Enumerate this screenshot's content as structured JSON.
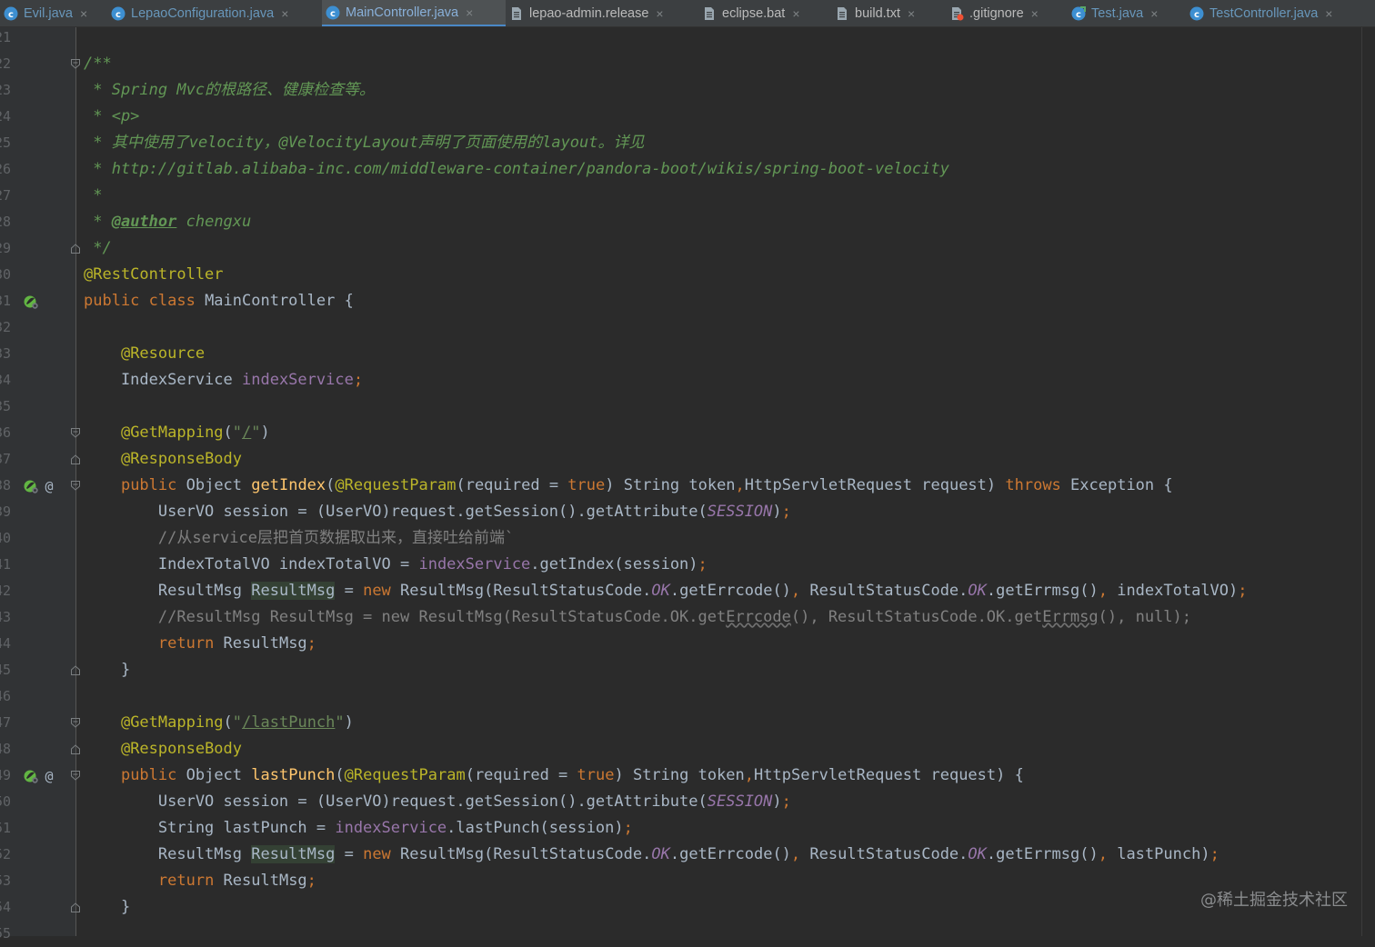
{
  "tabs": [
    {
      "label": "Evil.java",
      "kind": "java",
      "active": false
    },
    {
      "label": "LepaoConfiguration.java",
      "kind": "java",
      "active": false
    },
    {
      "label": "MainController.java",
      "kind": "java",
      "active": true
    },
    {
      "label": "lepao-admin.release",
      "kind": "file",
      "active": false
    },
    {
      "label": "eclipse.bat",
      "kind": "file",
      "active": false
    },
    {
      "label": "build.txt",
      "kind": "file",
      "active": false
    },
    {
      "label": ".gitignore",
      "kind": "git",
      "active": false
    },
    {
      "label": "Test.java",
      "kind": "java-test",
      "active": false
    },
    {
      "label": "TestController.java",
      "kind": "java",
      "active": false
    }
  ],
  "close_glyph": "×",
  "lines": [
    {
      "n": "21",
      "tokens": []
    },
    {
      "n": "22",
      "fold": "open",
      "tokens": [
        {
          "t": "/**",
          "c": "doc"
        }
      ]
    },
    {
      "n": "23",
      "tokens": [
        {
          "t": " * Spring Mvc的根路径、健康检查等。",
          "c": "doc"
        }
      ]
    },
    {
      "n": "24",
      "tokens": [
        {
          "t": " * <p>",
          "c": "doc"
        }
      ]
    },
    {
      "n": "25",
      "tokens": [
        {
          "t": " * 其中使用了velocity，@VelocityLayout声明了页面使用的layout。详见",
          "c": "doc"
        }
      ]
    },
    {
      "n": "26",
      "tokens": [
        {
          "t": " * http://gitlab.alibaba-inc.com/middleware-container/pandora-boot/wikis/spring-boot-velocity",
          "c": "doc"
        }
      ]
    },
    {
      "n": "27",
      "tokens": [
        {
          "t": " *",
          "c": "doc"
        }
      ]
    },
    {
      "n": "28",
      "tokens": [
        {
          "t": " * ",
          "c": "doc"
        },
        {
          "t": "@author",
          "c": "doctag"
        },
        {
          "t": " chengxu",
          "c": "doc"
        }
      ]
    },
    {
      "n": "29",
      "fold": "close",
      "tokens": [
        {
          "t": " */",
          "c": "doc"
        }
      ]
    },
    {
      "n": "30",
      "tokens": [
        {
          "t": "@RestController",
          "c": "ann"
        }
      ]
    },
    {
      "n": "31",
      "icon": "bean",
      "tokens": [
        {
          "t": "public class ",
          "c": "kw"
        },
        {
          "t": "MainController {"
        }
      ]
    },
    {
      "n": "32",
      "tokens": []
    },
    {
      "n": "33",
      "tokens": [
        {
          "t": "    "
        },
        {
          "t": "@Resource",
          "c": "ann"
        }
      ]
    },
    {
      "n": "34",
      "tokens": [
        {
          "t": "    IndexService "
        },
        {
          "t": "indexService",
          "c": "field"
        },
        {
          "t": ";",
          "c": "kw"
        }
      ]
    },
    {
      "n": "35",
      "tokens": []
    },
    {
      "n": "36",
      "fold": "open",
      "tokens": [
        {
          "t": "    "
        },
        {
          "t": "@GetMapping",
          "c": "ann"
        },
        {
          "t": "("
        },
        {
          "t": "\"",
          "c": "str"
        },
        {
          "t": "/",
          "c": "str ul"
        },
        {
          "t": "\"",
          "c": "str"
        },
        {
          "t": ")"
        }
      ]
    },
    {
      "n": "37",
      "fold": "close",
      "tokens": [
        {
          "t": "    "
        },
        {
          "t": "@ResponseBody",
          "c": "ann"
        }
      ]
    },
    {
      "n": "38",
      "icon": "bean",
      "at": "@",
      "fold": "open",
      "tokens": [
        {
          "t": "    "
        },
        {
          "t": "public ",
          "c": "kw"
        },
        {
          "t": "Object "
        },
        {
          "t": "getIndex",
          "c": "fn"
        },
        {
          "t": "("
        },
        {
          "t": "@RequestParam",
          "c": "ann"
        },
        {
          "t": "(required = "
        },
        {
          "t": "true",
          "c": "kw"
        },
        {
          "t": ") String token"
        },
        {
          "t": ",",
          "c": "kw"
        },
        {
          "t": "HttpServletRequest request) "
        },
        {
          "t": "throws ",
          "c": "kw"
        },
        {
          "t": "Exception {"
        }
      ]
    },
    {
      "n": "39",
      "tokens": [
        {
          "t": "        UserVO session = (UserVO)request.getSession().getAttribute("
        },
        {
          "t": "SESSION",
          "c": "cst"
        },
        {
          "t": ")"
        },
        {
          "t": ";",
          "c": "kw"
        }
      ]
    },
    {
      "n": "40",
      "tokens": [
        {
          "t": "        //从service层把首页数据取出来，直接吐给前端`",
          "c": "cmt"
        }
      ]
    },
    {
      "n": "41",
      "tokens": [
        {
          "t": "        IndexTotalVO indexTotalVO = "
        },
        {
          "t": "indexService",
          "c": "field"
        },
        {
          "t": ".getIndex(session)"
        },
        {
          "t": ";",
          "c": "kw"
        }
      ]
    },
    {
      "n": "42",
      "tokens": [
        {
          "t": "        ResultMsg "
        },
        {
          "t": "ResultMsg",
          "c": "hl"
        },
        {
          "t": " = "
        },
        {
          "t": "new ",
          "c": "kw"
        },
        {
          "t": "ResultMsg(ResultStatusCode."
        },
        {
          "t": "OK",
          "c": "cst"
        },
        {
          "t": ".getErrcode()"
        },
        {
          "t": ", ",
          "c": "kw"
        },
        {
          "t": "ResultStatusCode."
        },
        {
          "t": "OK",
          "c": "cst"
        },
        {
          "t": ".getErrmsg()"
        },
        {
          "t": ", ",
          "c": "kw"
        },
        {
          "t": "indexTotalVO)"
        },
        {
          "t": ";",
          "c": "kw"
        }
      ]
    },
    {
      "n": "43",
      "tokens": [
        {
          "t": "        //ResultMsg ResultMsg = new ResultMsg(ResultStatusCode.OK.get",
          "c": "cmt"
        },
        {
          "t": "Errcode",
          "c": "cmt wavy"
        },
        {
          "t": "(), ResultStatusCode.OK.get",
          "c": "cmt"
        },
        {
          "t": "Errmsg",
          "c": "cmt wavy"
        },
        {
          "t": "(), null);",
          "c": "cmt"
        }
      ]
    },
    {
      "n": "44",
      "tokens": [
        {
          "t": "        "
        },
        {
          "t": "return ",
          "c": "kw"
        },
        {
          "t": "ResultMsg"
        },
        {
          "t": ";",
          "c": "kw"
        }
      ]
    },
    {
      "n": "45",
      "fold": "close",
      "tokens": [
        {
          "t": "    }"
        }
      ]
    },
    {
      "n": "46",
      "tokens": []
    },
    {
      "n": "47",
      "fold": "open",
      "tokens": [
        {
          "t": "    "
        },
        {
          "t": "@GetMapping",
          "c": "ann"
        },
        {
          "t": "("
        },
        {
          "t": "\"",
          "c": "str"
        },
        {
          "t": "/lastPunch",
          "c": "str ul"
        },
        {
          "t": "\"",
          "c": "str"
        },
        {
          "t": ")"
        }
      ]
    },
    {
      "n": "48",
      "fold": "close",
      "tokens": [
        {
          "t": "    "
        },
        {
          "t": "@ResponseBody",
          "c": "ann"
        }
      ]
    },
    {
      "n": "49",
      "icon": "bean",
      "at": "@",
      "fold": "open",
      "tokens": [
        {
          "t": "    "
        },
        {
          "t": "public ",
          "c": "kw"
        },
        {
          "t": "Object "
        },
        {
          "t": "lastPunch",
          "c": "fn"
        },
        {
          "t": "("
        },
        {
          "t": "@RequestParam",
          "c": "ann"
        },
        {
          "t": "(required = "
        },
        {
          "t": "true",
          "c": "kw"
        },
        {
          "t": ") String token"
        },
        {
          "t": ",",
          "c": "kw"
        },
        {
          "t": "HttpServletRequest request) {"
        }
      ]
    },
    {
      "n": "50",
      "tokens": [
        {
          "t": "        UserVO session = (UserVO)request.getSession().getAttribute("
        },
        {
          "t": "SESSION",
          "c": "cst"
        },
        {
          "t": ")"
        },
        {
          "t": ";",
          "c": "kw"
        }
      ]
    },
    {
      "n": "51",
      "tokens": [
        {
          "t": "        String lastPunch = "
        },
        {
          "t": "indexService",
          "c": "field"
        },
        {
          "t": ".lastPunch(session)"
        },
        {
          "t": ";",
          "c": "kw"
        }
      ]
    },
    {
      "n": "52",
      "tokens": [
        {
          "t": "        ResultMsg "
        },
        {
          "t": "ResultMsg",
          "c": "hl"
        },
        {
          "t": " = "
        },
        {
          "t": "new ",
          "c": "kw"
        },
        {
          "t": "ResultMsg(ResultStatusCode."
        },
        {
          "t": "OK",
          "c": "cst"
        },
        {
          "t": ".getErrcode()"
        },
        {
          "t": ", ",
          "c": "kw"
        },
        {
          "t": "ResultStatusCode."
        },
        {
          "t": "OK",
          "c": "cst"
        },
        {
          "t": ".getErrmsg()"
        },
        {
          "t": ", ",
          "c": "kw"
        },
        {
          "t": "lastPunch)"
        },
        {
          "t": ";",
          "c": "kw"
        }
      ]
    },
    {
      "n": "53",
      "tokens": [
        {
          "t": "        "
        },
        {
          "t": "return ",
          "c": "kw"
        },
        {
          "t": "ResultMsg"
        },
        {
          "t": ";",
          "c": "kw"
        }
      ]
    },
    {
      "n": "54",
      "fold": "close",
      "tokens": [
        {
          "t": "    }"
        }
      ]
    },
    {
      "n": "55",
      "tokens": []
    }
  ],
  "watermark": "@稀土掘金技术社区",
  "colors": {
    "background": "#2b2b2b",
    "gutter": "#313335",
    "keyword": "#cc7832",
    "annotation": "#bbb529",
    "doc_comment": "#629755",
    "string": "#6a8759",
    "field": "#9876aa",
    "method": "#ffc66d",
    "comment": "#808080",
    "text": "#a9b7c6",
    "active_tab_underline": "#4a88c7"
  }
}
